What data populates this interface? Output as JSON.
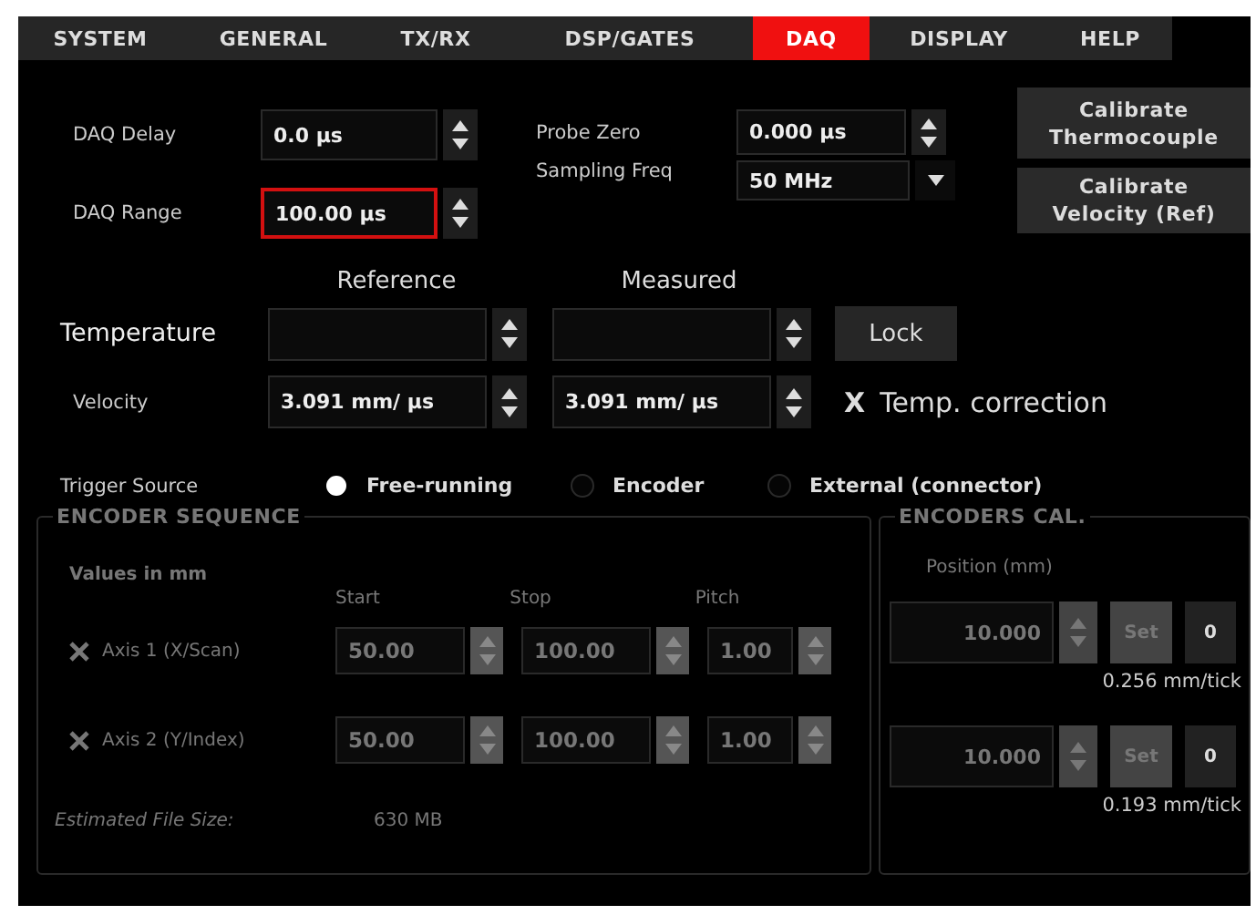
{
  "tabs": [
    {
      "label": "SYSTEM",
      "selected": false
    },
    {
      "label": "GENERAL",
      "selected": false
    },
    {
      "label": "TX/RX",
      "selected": false
    },
    {
      "label": "DSP/GATES",
      "selected": false
    },
    {
      "label": "DAQ",
      "selected": true
    },
    {
      "label": "DISPLAY",
      "selected": false
    },
    {
      "label": "HELP",
      "selected": false
    }
  ],
  "daq_fields": [
    {
      "label": "DAQ Delay",
      "value": "0.0 µs",
      "focused": false
    },
    {
      "label": "DAQ Range",
      "value": "100.00 µs",
      "focused": true
    }
  ],
  "probe_zero": {
    "label": "Probe Zero",
    "value": "0.000 µs"
  },
  "sampling_freq": {
    "label": "Sampling Freq",
    "value": "50 MHz"
  },
  "calibrate_buttons": [
    "Calibrate Thermocouple",
    "Calibrate Velocity (Ref)"
  ],
  "columns": [
    "Reference",
    "Measured"
  ],
  "temperature": {
    "label": "Temperature",
    "button": "Lock"
  },
  "velocity": {
    "label": "Velocity",
    "reference": "3.091 mm/ µs",
    "measured": "3.091 mm/ µs"
  },
  "temp_correction": {
    "mark": "X",
    "label": "Temp. correction"
  },
  "trigger": {
    "label": "Trigger Source",
    "options": [
      {
        "label": "Free-running",
        "selected": true
      },
      {
        "label": "Encoder",
        "selected": false
      },
      {
        "label": "External (connector)",
        "selected": false
      }
    ]
  },
  "encoder_sequence": {
    "title": "ENCODER SEQUENCE",
    "disabled": true,
    "note": "Values in mm",
    "columns": [
      "Start",
      "Stop",
      "Pitch"
    ],
    "axes": [
      {
        "label": "Axis 1 (X/Scan)",
        "start": "50.00",
        "stop": "100.00",
        "pitch": "1.00"
      },
      {
        "label": "Axis 2 (Y/Index)",
        "start": "50.00",
        "stop": "100.00",
        "pitch": "1.00"
      }
    ],
    "file_size_label": "Estimated File Size:",
    "file_size": "630 MB"
  },
  "encoders_cal": {
    "title": "ENCODERS CAL.",
    "disabled": true,
    "column": "Position (mm)",
    "rows": [
      {
        "value": "10.000",
        "set": "Set",
        "zero": "0",
        "resolution": "0.256 mm/tick"
      },
      {
        "value": "10.000",
        "set": "Set",
        "zero": "0",
        "resolution": "0.193 mm/tick"
      }
    ]
  }
}
